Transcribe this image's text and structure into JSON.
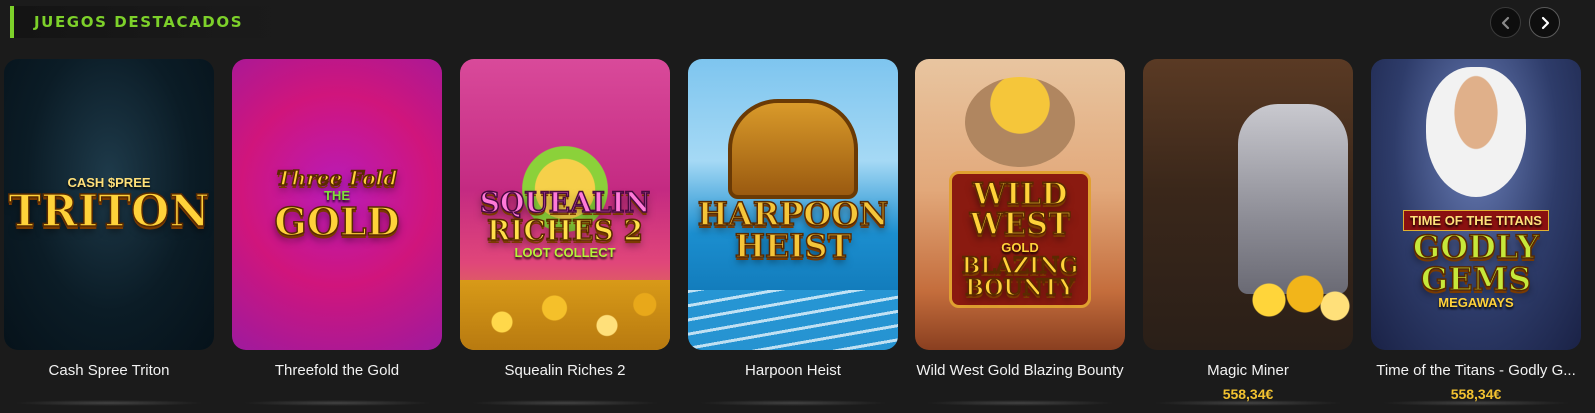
{
  "section": {
    "title": "JUEGOS DESTACADOS"
  },
  "nav": {
    "prev_icon": "chevron-left-icon",
    "next_icon": "chevron-right-icon"
  },
  "colors": {
    "accent": "#7dd12a",
    "jackpot": "#f2c230",
    "background": "#1b1b1b"
  },
  "games": [
    {
      "name": "Cash Spree Triton",
      "jackpot": "",
      "logo_lines": [
        "CASH $PREE",
        "TRITON"
      ]
    },
    {
      "name": "Threefold the Gold",
      "jackpot": "",
      "logo_lines": [
        "Three Fold",
        "THE",
        "GOLD"
      ]
    },
    {
      "name": "Squealin Riches 2",
      "jackpot": "",
      "logo_lines": [
        "SQUEALIN",
        "RICHES 2",
        "LOOT COLLECT"
      ]
    },
    {
      "name": "Harpoon Heist",
      "jackpot": "",
      "logo_lines": [
        "HARPOON",
        "HEIST"
      ]
    },
    {
      "name": "Wild West Gold Blazing Bounty",
      "jackpot": "",
      "logo_lines": [
        "WILD",
        "WEST",
        "GOLD",
        "BLAZING",
        "BOUNTY"
      ]
    },
    {
      "name": "Magic Miner",
      "jackpot": "558,34€",
      "logo_lines": []
    },
    {
      "name": "Time of the Titans - Godly G...",
      "jackpot": "558,34€",
      "logo_lines": [
        "TIME OF THE TITANS",
        "GODLY",
        "GEMS",
        "MEGAWAYS"
      ]
    }
  ]
}
